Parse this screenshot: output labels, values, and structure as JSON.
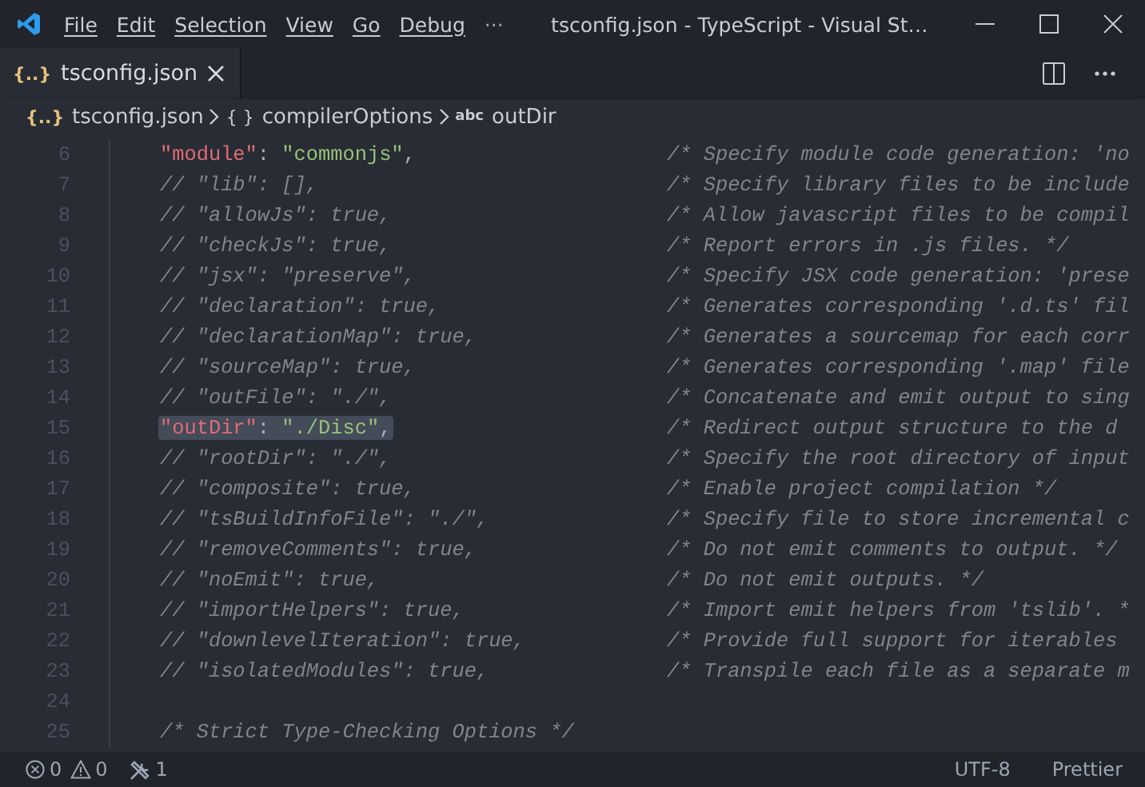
{
  "window": {
    "menu": [
      "File",
      "Edit",
      "Selection",
      "View",
      "Go",
      "Debug",
      "···"
    ],
    "title": "tsconfig.json - TypeScript - Visual St…"
  },
  "tabs": [
    {
      "icon": "{..}",
      "label": "tsconfig.json",
      "selected": true
    }
  ],
  "breadcrumb": [
    {
      "icon": "{..}",
      "kind": "file",
      "label": "tsconfig.json"
    },
    {
      "icon": "{ }",
      "kind": "object",
      "label": "compilerOptions"
    },
    {
      "icon": "abc",
      "kind": "string",
      "label": "outDir"
    }
  ],
  "editor": {
    "lines": [
      {
        "number": "6",
        "code": [
          {
            "text": "\"module\"",
            "kind": "key"
          },
          {
            "text": ": ",
            "kind": "punct"
          },
          {
            "text": "\"commonjs\"",
            "kind": "string"
          },
          {
            "text": ",",
            "kind": "punct"
          }
        ],
        "comment": "/* Specify module code generation: 'no",
        "highlighted": false
      },
      {
        "number": "7",
        "code": [
          {
            "text": "// \"lib\": [],",
            "kind": "comment"
          }
        ],
        "comment": "/* Specify library files to be include",
        "highlighted": false
      },
      {
        "number": "8",
        "code": [
          {
            "text": "// \"allowJs\": true,",
            "kind": "comment"
          }
        ],
        "comment": "/* Allow javascript files to be compil",
        "highlighted": false
      },
      {
        "number": "9",
        "code": [
          {
            "text": "// \"checkJs\": true,",
            "kind": "comment"
          }
        ],
        "comment": "/* Report errors in .js files. */",
        "highlighted": false
      },
      {
        "number": "10",
        "code": [
          {
            "text": "// \"jsx\": \"preserve\",",
            "kind": "comment"
          }
        ],
        "comment": "/* Specify JSX code generation: 'prese",
        "highlighted": false
      },
      {
        "number": "11",
        "code": [
          {
            "text": "// \"declaration\": true,",
            "kind": "comment"
          }
        ],
        "comment": "/* Generates corresponding '.d.ts' fil",
        "highlighted": false
      },
      {
        "number": "12",
        "code": [
          {
            "text": "// \"declarationMap\": true,",
            "kind": "comment"
          }
        ],
        "comment": "/* Generates a sourcemap for each corr",
        "highlighted": false
      },
      {
        "number": "13",
        "code": [
          {
            "text": "// \"sourceMap\": true,",
            "kind": "comment"
          }
        ],
        "comment": "/* Generates corresponding '.map' file",
        "highlighted": false
      },
      {
        "number": "14",
        "code": [
          {
            "text": "// \"outFile\": \"./\",",
            "kind": "comment"
          }
        ],
        "comment": "/* Concatenate and emit output to sing",
        "highlighted": false
      },
      {
        "number": "15",
        "code": [
          {
            "text": "\"outDir\"",
            "kind": "key"
          },
          {
            "text": ": ",
            "kind": "punct"
          },
          {
            "text": "\"./Disc\"",
            "kind": "string"
          },
          {
            "text": ",",
            "kind": "punct"
          }
        ],
        "comment": "/* Redirect output structure to the d",
        "highlighted": true
      },
      {
        "number": "16",
        "code": [
          {
            "text": "// \"rootDir\": \"./\",",
            "kind": "comment"
          }
        ],
        "comment": "/* Specify the root directory of input",
        "highlighted": false
      },
      {
        "number": "17",
        "code": [
          {
            "text": "// \"composite\": true,",
            "kind": "comment"
          }
        ],
        "comment": "/* Enable project compilation */",
        "highlighted": false
      },
      {
        "number": "18",
        "code": [
          {
            "text": "// \"tsBuildInfoFile\": \"./\",",
            "kind": "comment"
          }
        ],
        "comment": "/* Specify file to store incremental c",
        "highlighted": false
      },
      {
        "number": "19",
        "code": [
          {
            "text": "// \"removeComments\": true,",
            "kind": "comment"
          }
        ],
        "comment": "/* Do not emit comments to output. */",
        "highlighted": false
      },
      {
        "number": "20",
        "code": [
          {
            "text": "// \"noEmit\": true,",
            "kind": "comment"
          }
        ],
        "comment": "/* Do not emit outputs. */",
        "highlighted": false
      },
      {
        "number": "21",
        "code": [
          {
            "text": "// \"importHelpers\": true,",
            "kind": "comment"
          }
        ],
        "comment": "/* Import emit helpers from 'tslib'. *",
        "highlighted": false
      },
      {
        "number": "22",
        "code": [
          {
            "text": "// \"downlevelIteration\": true,",
            "kind": "comment"
          }
        ],
        "comment": "/* Provide full support for iterables",
        "highlighted": false
      },
      {
        "number": "23",
        "code": [
          {
            "text": "// \"isolatedModules\": true,",
            "kind": "comment"
          }
        ],
        "comment": "/* Transpile each file as a separate m",
        "highlighted": false
      },
      {
        "number": "24",
        "highlighted": false
      },
      {
        "number": "25",
        "code": [
          {
            "text": "/* Strict Type-Checking Options */",
            "kind": "comment"
          }
        ],
        "highlighted": false
      }
    ]
  },
  "status_bar": {
    "errors": "0",
    "warnings": "0",
    "tools": "1",
    "encoding": "UTF-8",
    "formatter": "Prettier"
  }
}
